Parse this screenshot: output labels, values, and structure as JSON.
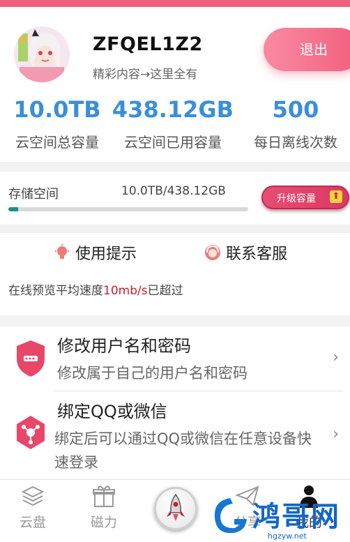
{
  "profile": {
    "username": "ZFQEL1Z2",
    "tagline": "精彩内容→这里全有",
    "logout_label": "退出"
  },
  "stats": [
    {
      "value": "10.0TB",
      "label": "云空间总容量"
    },
    {
      "value": "438.12GB",
      "label": "云空间已用容量"
    },
    {
      "value": "500",
      "label": "每日离线次数"
    }
  ],
  "storage": {
    "label": "存储空间",
    "value": "10.0TB/438.12GB",
    "used_fraction": 0.04,
    "upgrade_label": "升级容量",
    "upgrade_icon": "up-arrow-icon"
  },
  "tips": {
    "usage_tips": "使用提示",
    "contact_support": "联系客服"
  },
  "notice": {
    "prefix": "在线预览平均速度",
    "highlight": "10mb/s",
    "suffix": "已超过"
  },
  "settings": [
    {
      "title": "修改用户名和密码",
      "desc": "修改属于自己的用户名和密码",
      "icon": "shield-lock-icon"
    },
    {
      "title": "绑定QQ或微信",
      "desc": "绑定后可以通过QQ或微信在任意设备快速登录",
      "icon": "link-nodes-icon"
    }
  ],
  "bottom_nav": [
    {
      "label": "云盘",
      "icon": "layers-icon"
    },
    {
      "label": "磁力",
      "icon": "gift-icon"
    },
    {
      "label": "",
      "icon": "rocket-icon"
    },
    {
      "label": "分享",
      "icon": "paper-plane-icon"
    },
    {
      "label": "我的",
      "icon": "person-icon"
    }
  ],
  "watermark": {
    "main": "鸿哥网",
    "sub": "hgzyw.net"
  },
  "colors": {
    "accent_pink": "#f0607e",
    "stat_blue": "#3a8fd8",
    "progress_teal": "#1a8f8f",
    "highlight_red": "#c8202e"
  }
}
